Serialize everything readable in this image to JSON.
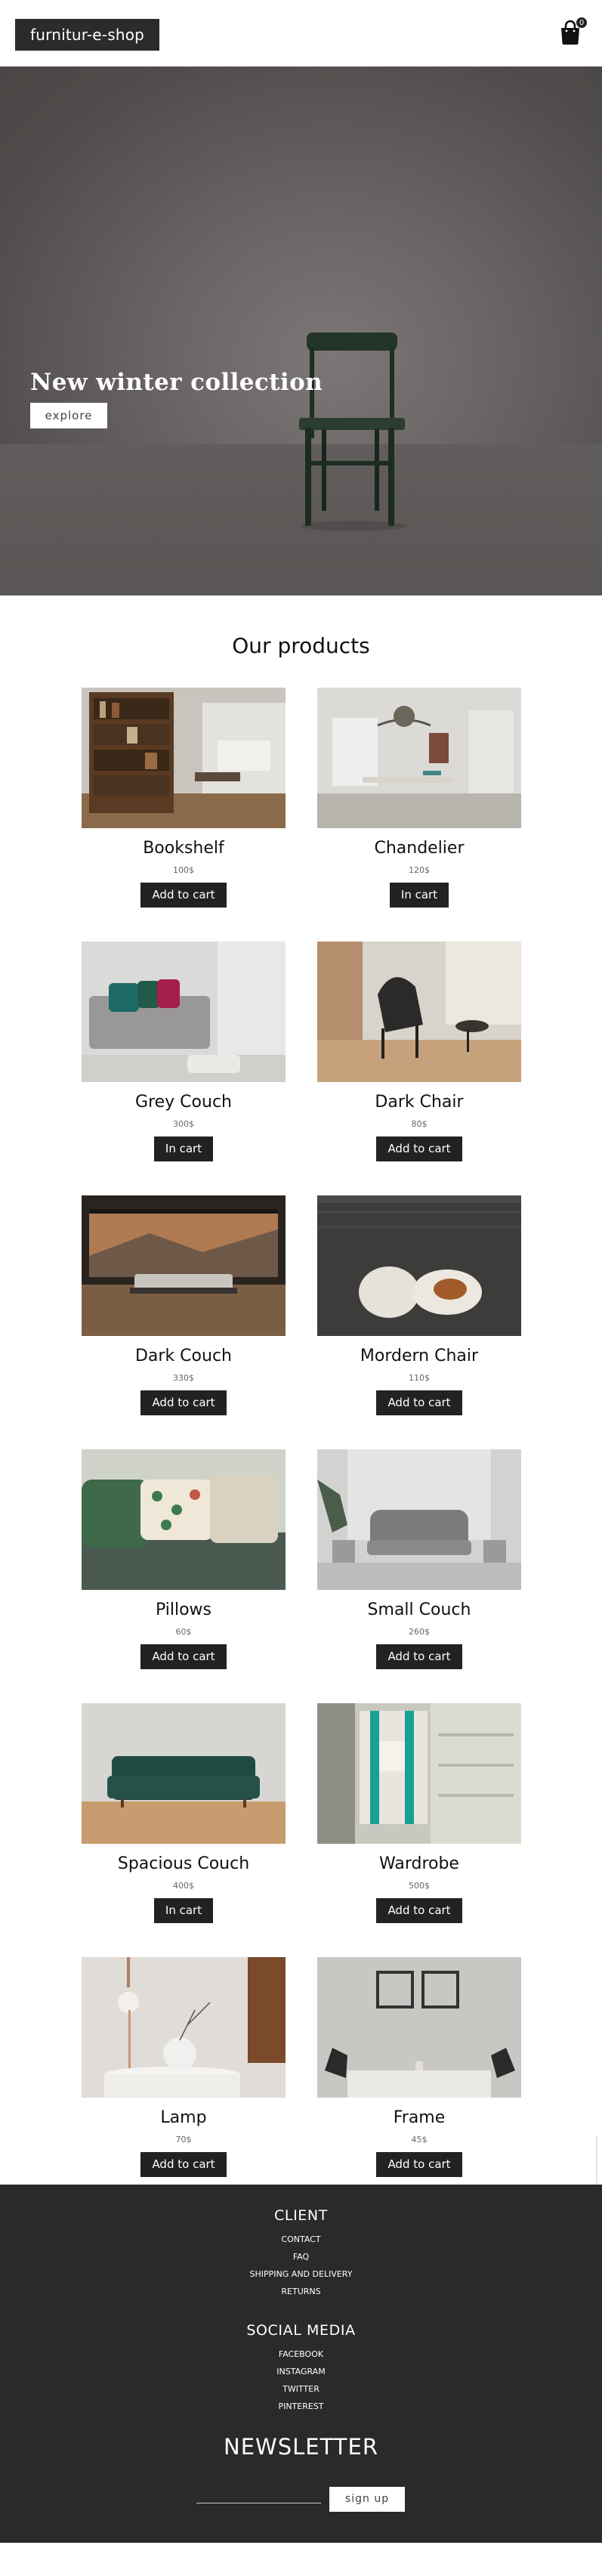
{
  "header": {
    "logo": "furnitur-e-shop",
    "cart_count": "0"
  },
  "hero": {
    "title": "New winter collection",
    "button": "explore"
  },
  "products_title": "Our products",
  "products": [
    {
      "name": "Bookshelf",
      "price": "100$",
      "button": "Add to cart",
      "image": "bookshelf-photo"
    },
    {
      "name": "Chandelier",
      "price": "120$",
      "button": "In cart",
      "image": "chandelier-photo"
    },
    {
      "name": "Grey Couch",
      "price": "300$",
      "button": "In cart",
      "image": "grey-couch-photo"
    },
    {
      "name": "Dark Chair",
      "price": "80$",
      "button": "Add to cart",
      "image": "dark-chair-photo"
    },
    {
      "name": "Dark Couch",
      "price": "330$",
      "button": "Add to cart",
      "image": "dark-couch-photo"
    },
    {
      "name": "Mordern Chair",
      "price": "110$",
      "button": "Add to cart",
      "image": "modern-chair-photo"
    },
    {
      "name": "Pillows",
      "price": "60$",
      "button": "Add to cart",
      "image": "pillows-photo"
    },
    {
      "name": "Small Couch",
      "price": "260$",
      "button": "Add to cart",
      "image": "small-couch-photo"
    },
    {
      "name": "Spacious Couch",
      "price": "400$",
      "button": "In cart",
      "image": "spacious-couch-photo"
    },
    {
      "name": "Wardrobe",
      "price": "500$",
      "button": "Add to cart",
      "image": "wardrobe-photo"
    },
    {
      "name": "Lamp",
      "price": "70$",
      "button": "Add to cart",
      "image": "lamp-photo"
    },
    {
      "name": "Frame",
      "price": "45$",
      "button": "Add to cart",
      "image": "frame-photo"
    }
  ],
  "footer": {
    "client_heading": "CLIENT",
    "client_links": [
      "CONTACT",
      "FAQ",
      "SHIPPING AND DELIVERY",
      "RETURNS"
    ],
    "social_heading": "SOCIAL MEDIA",
    "social_links": [
      "FACEBOOK",
      "INSTAGRAM",
      "TWITTER",
      "PINTEREST"
    ],
    "newsletter_title": "NEWSLETTER",
    "signup_button": "sign up"
  },
  "colors": {
    "dark": "#222222",
    "footer": "#2a2a2a",
    "hero": "#6a6564"
  }
}
